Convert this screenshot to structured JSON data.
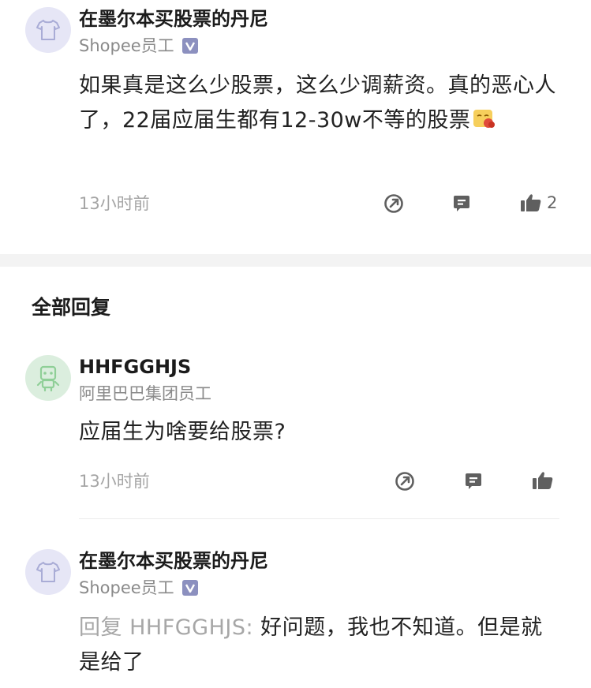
{
  "top_comment": {
    "author": "在墨尔本买股票的丹尼",
    "company": "Shopee员工",
    "verified_badge": "V",
    "text": "如果真是这么少股票，这么少调薪资。真的恶心人了，22届应届生都有12-30w不等的股票",
    "emoji": "sick-face-emoji",
    "time": "13小时前",
    "like_count": "2"
  },
  "section_title": "全部回复",
  "replies": [
    {
      "author": "HHFGGHJS",
      "company": "阿里巴巴集团员工",
      "text": "应届生为啥要给股票?",
      "time": "13小时前"
    },
    {
      "author": "在墨尔本买股票的丹尼",
      "company": "Shopee员工",
      "verified_badge": "V",
      "reply_prefix": "回复 HHFGGHJS: ",
      "text": "好问题，我也不知道。但是就是给了"
    }
  ],
  "icons": [
    "tshirt-avatar-icon",
    "robot-avatar-icon",
    "share-icon",
    "comment-icon",
    "thumbs-up-icon"
  ],
  "colors": {
    "icon_gray": "#5f5f5f",
    "badge": "#8c90bf",
    "divider": "#f3f3f3"
  }
}
